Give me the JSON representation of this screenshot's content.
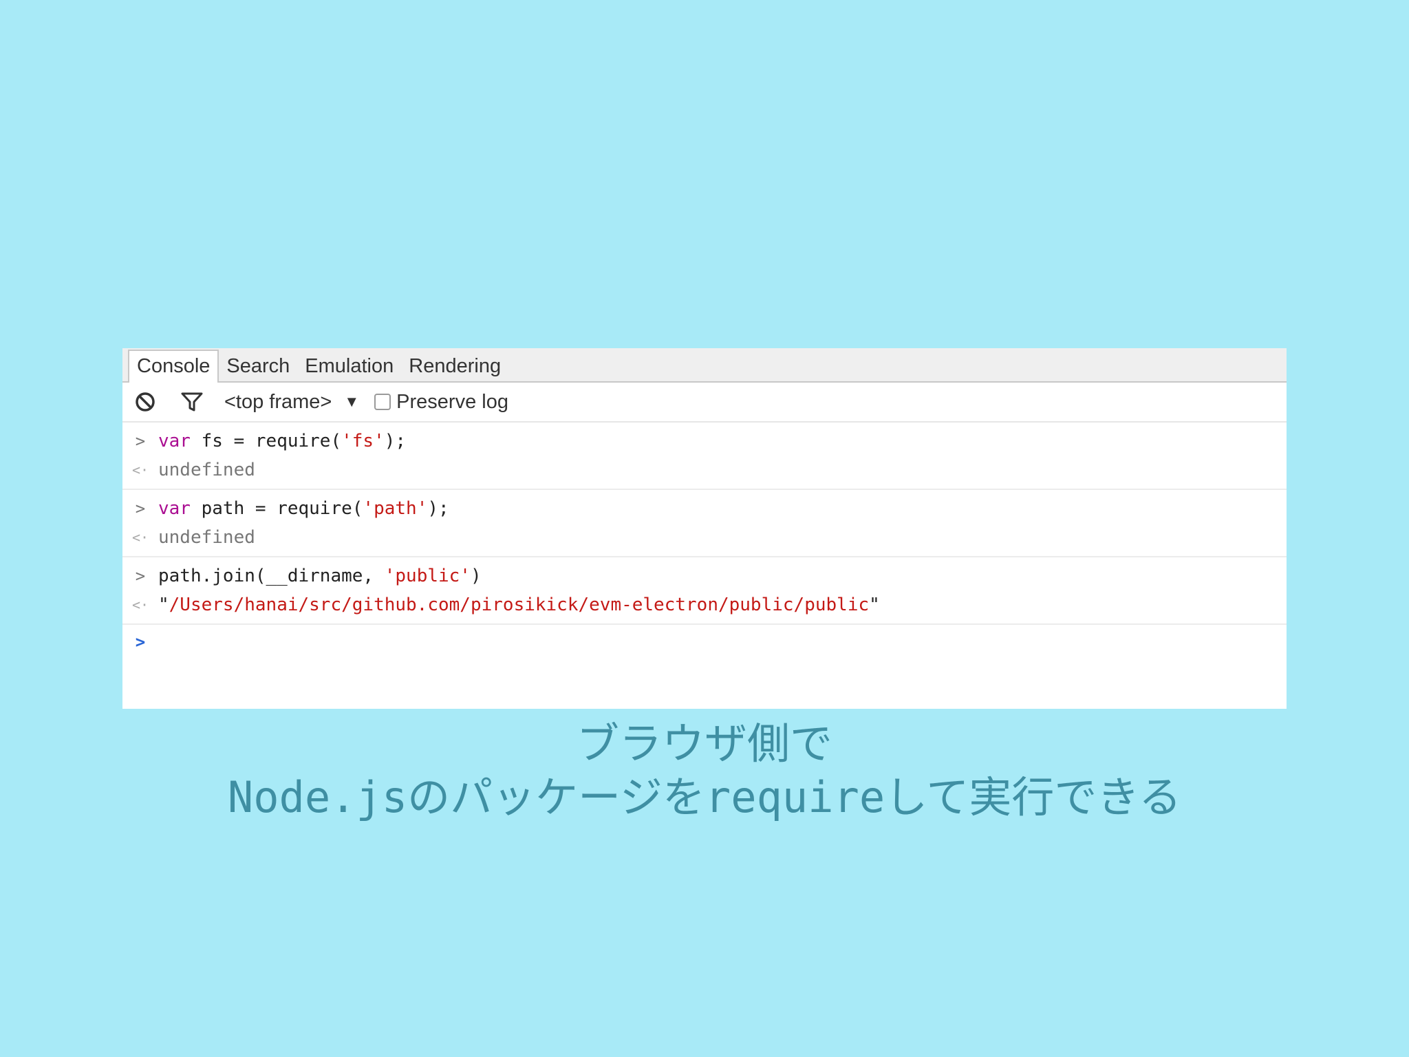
{
  "tabs": [
    {
      "label": "Console"
    },
    {
      "label": "Search"
    },
    {
      "label": "Emulation"
    },
    {
      "label": "Rendering"
    }
  ],
  "toolbar": {
    "clear_icon": "clear-console-icon",
    "filter_icon": "filter-icon",
    "frame_label": "<top frame>",
    "frame_arrow": "▼",
    "preserve_log_label": "Preserve log",
    "preserve_log_checked": false
  },
  "console": {
    "entries": [
      {
        "input": {
          "kw": "var",
          "code": " fs = require(",
          "str": "'fs'",
          "tail": ");"
        },
        "output": "undefined"
      },
      {
        "input": {
          "kw": "var",
          "code": " path = require(",
          "str": "'path'",
          "tail": ");"
        },
        "output": "undefined"
      },
      {
        "input": {
          "kw": "",
          "code": "path.join(__dirname, ",
          "str": "'public'",
          "tail": ")"
        },
        "output_quote_open": "\"",
        "output": "/Users/hanai/src/github.com/pirosikick/evm-electron/public/public",
        "output_quote_close": "\""
      }
    ],
    "prompt_symbol": ">",
    "result_symbol": "<·"
  },
  "caption": {
    "line1": "ブラウザ側で",
    "line2": "Node.jsのパッケージをrequireして実行できる"
  },
  "colors": {
    "background": "#a8eaf7",
    "keyword": "#aa0d91",
    "string": "#c41a16",
    "caption": "#3f8fa3",
    "prompt_active": "#2a66d6"
  }
}
